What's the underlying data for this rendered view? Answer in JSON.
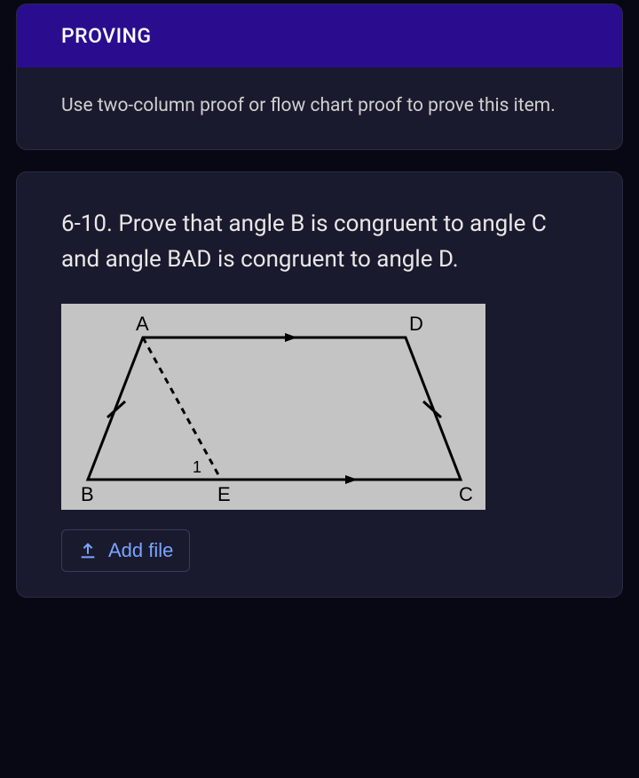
{
  "card1": {
    "header": "PROVING",
    "instruction": "Use two-column proof or flow chart proof to prove this item."
  },
  "card2": {
    "problem": "6-10. Prove that angle B is congruent to angle C and angle BAD is congruent to angle D.",
    "figure": {
      "labels": {
        "A": "A",
        "B": "B",
        "C": "C",
        "D": "D",
        "E": "E",
        "angle1": "1"
      }
    },
    "add_file_label": "Add file"
  }
}
